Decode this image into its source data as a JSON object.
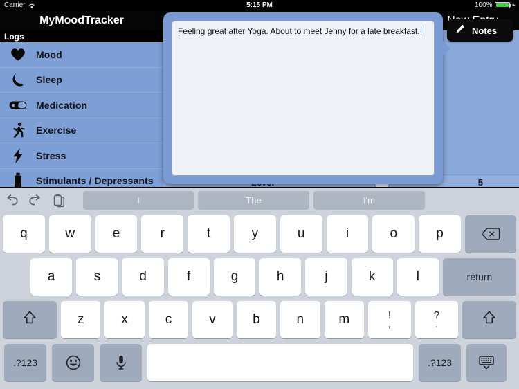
{
  "status_bar": {
    "carrier": "Carrier",
    "wifi_icon": "wifi-icon",
    "time": "5:15 PM",
    "battery_percent": "100%",
    "battery_icon": "battery-full-icon",
    "charging_icon": "charging-bolt-icon"
  },
  "sidebar": {
    "app_title": "MyMoodTracker",
    "section_header": "Logs",
    "items": [
      {
        "label": "Mood",
        "icon": "heart-icon"
      },
      {
        "label": "Sleep",
        "icon": "moon-icon"
      },
      {
        "label": "Medication",
        "icon": "pill-icon"
      },
      {
        "label": "Exercise",
        "icon": "running-person-icon"
      },
      {
        "label": "Stress",
        "icon": "lightning-bolt-icon"
      },
      {
        "label": "Stimulants / Depressants",
        "icon": "bottle-icon"
      }
    ]
  },
  "detail": {
    "nav_title": "New Entry",
    "notes_button_label": "Notes",
    "notes_button_icon": "pencil-icon",
    "level_field_label": "Level",
    "level_field_value": "5"
  },
  "popover": {
    "notes_text": "Feeling great after Yoga. About to meet Jenny for a late breakfast.",
    "caret_color": "#3b7ddd"
  },
  "keyboard": {
    "toolbar": {
      "undo_icon": "undo-arrow-icon",
      "redo_icon": "redo-arrow-icon",
      "paste_icon": "paste-clipboard-icon",
      "suggestions": [
        "I",
        "The",
        "I'm"
      ]
    },
    "row1": [
      "q",
      "w",
      "e",
      "r",
      "t",
      "y",
      "u",
      "i",
      "o",
      "p"
    ],
    "backspace_icon": "backspace-delete-icon",
    "row2": [
      "a",
      "s",
      "d",
      "f",
      "g",
      "h",
      "j",
      "k",
      "l"
    ],
    "return_label": "return",
    "row3": [
      "z",
      "x",
      "c",
      "v",
      "b",
      "n",
      "m"
    ],
    "punct_keys": [
      {
        "top": "!",
        "bottom": ","
      },
      {
        "top": "?",
        "bottom": "."
      }
    ],
    "shift_icon": "shift-arrow-icon",
    "row4": {
      "numbers_left_label": ".?123",
      "emoji_icon": "emoji-smiley-icon",
      "dictation_icon": "microphone-icon",
      "space_label": "",
      "numbers_right_label": ".?123",
      "hide_keyboard_icon": "hide-keyboard-icon"
    }
  },
  "colors": {
    "sidebar_bg": "#7e9ed6",
    "detail_bg": "#8aa8da",
    "navbar_bg": "#000000",
    "keyboard_bg": "#ced3db",
    "key_bg": "#ffffff",
    "key_dark_bg": "#9fabbc",
    "popover_bg": "#7a9ad3",
    "textarea_bg": "#eef2f7",
    "battery_green": "#3ad442"
  }
}
